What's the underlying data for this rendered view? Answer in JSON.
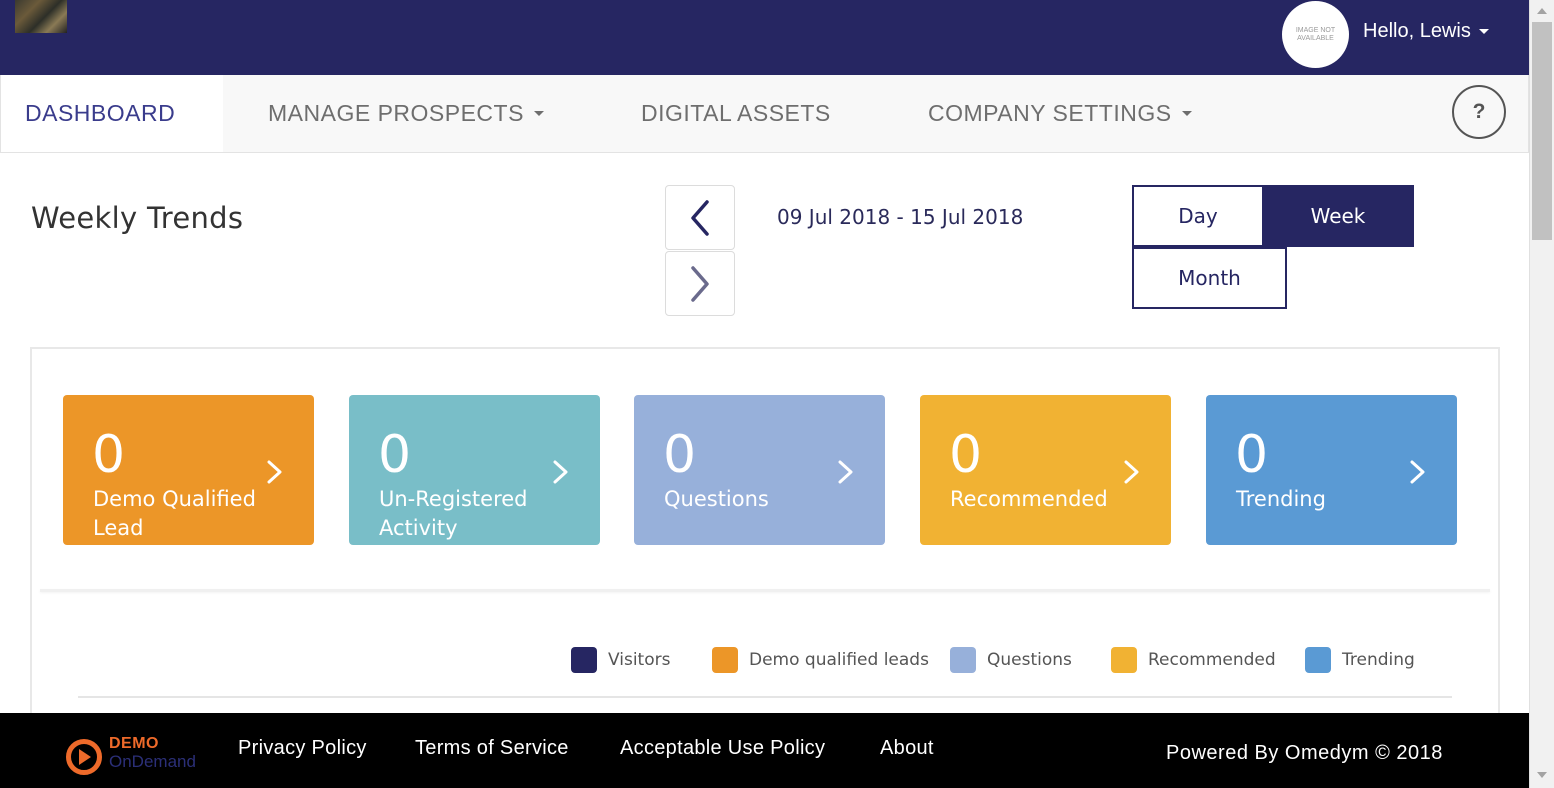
{
  "header": {
    "avatar_placeholder": "IMAGE NOT AVAILABLE",
    "greeting": "Hello, Lewis"
  },
  "nav": {
    "items": [
      {
        "label": "DASHBOARD",
        "active": true,
        "dropdown": false
      },
      {
        "label": "MANAGE PROSPECTS",
        "active": false,
        "dropdown": true
      },
      {
        "label": "DIGITAL ASSETS",
        "active": false,
        "dropdown": false
      },
      {
        "label": "COMPANY SETTINGS",
        "active": false,
        "dropdown": true
      }
    ],
    "help_label": "?"
  },
  "trends": {
    "title": "Weekly Trends",
    "date_range": "09 Jul 2018 - 15 Jul 2018",
    "periods": {
      "day": "Day",
      "week": "Week",
      "month": "Month",
      "selected": "Week"
    }
  },
  "cards": [
    {
      "count": "0",
      "label": "Demo Qualified Lead",
      "color": "#ec9628"
    },
    {
      "count": "0",
      "label": "Un-Registered Activity",
      "color": "#79bec8"
    },
    {
      "count": "0",
      "label": "Questions",
      "color": "#97b0da"
    },
    {
      "count": "0",
      "label": "Recommended",
      "color": "#f1b233"
    },
    {
      "count": "0",
      "label": "Trending",
      "color": "#5a9ad4"
    }
  ],
  "legend": [
    {
      "label": "Visitors",
      "color": "#262662"
    },
    {
      "label": "Demo qualified leads",
      "color": "#ec9628"
    },
    {
      "label": "Questions",
      "color": "#97b0da"
    },
    {
      "label": "Recommended",
      "color": "#f1b233"
    },
    {
      "label": "Trending",
      "color": "#5a9ad4"
    }
  ],
  "footer": {
    "logo_demo": "DEMO",
    "logo_ondemand": "OnDemand",
    "links": [
      "Privacy Policy",
      "Terms of Service",
      "Acceptable Use Policy",
      "About"
    ],
    "powered_by": "Powered By Omedym © 2018"
  },
  "colors": {
    "primary": "#262662",
    "accent_orange": "#ee6a2a"
  }
}
